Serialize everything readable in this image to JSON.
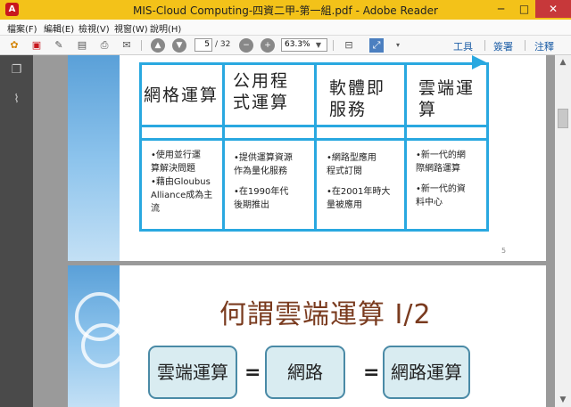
{
  "titlebar": {
    "logo": "A",
    "title": "MIS-Cloud Computing-四資二甲-第一組.pdf - Adobe Reader",
    "min": "─",
    "max": "□",
    "close": "✕"
  },
  "menubar": {
    "items": [
      "檔案(F)",
      "編輯(E)",
      "檢視(V)",
      "視窗(W)",
      "說明(H)"
    ]
  },
  "toolbar": {
    "page_value": "5",
    "page_total": "/ 32",
    "zoom_value": "63.3%",
    "tools": "工具",
    "sign": "簽署",
    "comment": "注釋"
  },
  "document": {
    "slide5": {
      "headers": [
        "網格運算",
        "公用程式運算",
        "軟體即服務",
        "雲端運算"
      ],
      "header_lines": [
        [
          "網格運算"
        ],
        [
          "公用程",
          "式運算"
        ],
        [
          "軟體即",
          "服務"
        ],
        [
          "雲端運",
          "算"
        ]
      ],
      "bodies": [
        [
          "•使用並行運",
          "算解決問題",
          "•藉由Gloubus",
          "Alliance成為主",
          "流"
        ],
        [
          "•提供運算資源",
          "作為量化服務",
          "",
          "•在1990年代",
          "後期推出"
        ],
        [
          "•網路型應用",
          "程式訂閱",
          "",
          "•在2001年時大",
          "量被應用"
        ],
        [
          "•新一代的網",
          "際網路運算",
          "",
          "•新一代的資",
          "料中心"
        ]
      ],
      "page_number": "5"
    },
    "slide6": {
      "heading": "何謂雲端運算 I/2",
      "box1": "雲端運算",
      "box2": "網路",
      "box3": "網路運算",
      "eq": "="
    }
  }
}
